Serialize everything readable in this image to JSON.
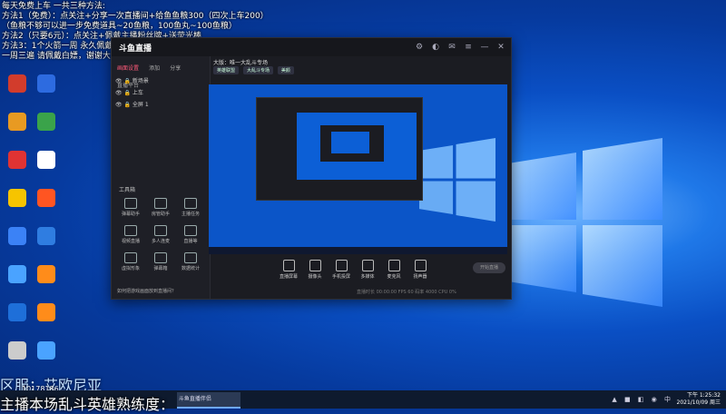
{
  "overlay": {
    "line1": "每天免费上车 一共三种方法:",
    "line2": "方法1（免费）：点关注+分享一次直播间+给鱼鱼粮300（四次上车200）",
    "line3": "（鱼粮不够可以进一步免费道具~20鱼粮，100鱼丸~100鱼粮）",
    "line4": "方法2（只要6元）：点关注+佩戴主播粉丝牌+送荧光棒",
    "line5": "方法3：1个火箭一周 永久佩戴粉丝牌可以每天会送你荧光棒",
    "line6": "一周三遍 请佩戴白嫖，谢谢大家的支持！"
  },
  "desktop_icons": [
    {
      "label": "",
      "color": "#d23c2c"
    },
    {
      "label": "",
      "color": "#2d6be0"
    },
    {
      "label": "",
      "color": "#e89a22"
    },
    {
      "label": "",
      "color": "#3aa34a"
    },
    {
      "label": "",
      "color": "#e03333"
    },
    {
      "label": "",
      "color": "#ffffff"
    },
    {
      "label": "",
      "color": "#f6c400"
    },
    {
      "label": "",
      "color": "#ff5522"
    },
    {
      "label": "",
      "color": "#3b82f6"
    },
    {
      "label": "",
      "color": "#2f7de1"
    },
    {
      "label": "",
      "color": "#4aa3ff"
    },
    {
      "label": "",
      "color": "#ff8c1a"
    },
    {
      "label": "",
      "color": "#1e6fd9"
    },
    {
      "label": "",
      "color": "#ff8c1a"
    },
    {
      "label": "",
      "color": "#cccccc"
    },
    {
      "label": "",
      "color": "#4aa3ff"
    }
  ],
  "app": {
    "logo_text": "斗鱼直播",
    "tabs": [
      "画面设置",
      "添加",
      "分享",
      "直播平台"
    ],
    "scenes": [
      "新场景",
      "上车",
      "全屏 1"
    ],
    "tools_title": "工具箱",
    "tools": [
      "弹幕助手",
      "房管助手",
      "主播任务",
      "视频直播",
      "多人连麦",
      "直播等",
      "虚拟形象",
      "弹幕箱",
      "数据统计"
    ],
    "left_footer": "如何把游戏画面放到直播间？",
    "room_label": "大版：唯一大乱斗专场",
    "chips": [
      "英雄联盟",
      "大乱斗专场",
      "美颜"
    ],
    "controls": [
      "直播屏幕",
      "摄像头",
      "手机投屏",
      "多媒体",
      "麦克风",
      "扬声器"
    ],
    "start_label": "开始直播",
    "status": "直播时长 00:00:00  FPS 60  码率 4000  CPU 0%"
  },
  "caption": {
    "line1": "区服：艾欧尼亚",
    "line1_small": "10178186",
    "line2": "主播本场乱斗英雄熟练度："
  },
  "taskbar": {
    "task_label": "斗鱼直播伴侣",
    "time": "下午 1:25:32",
    "date": "2021/10/09 周三"
  }
}
